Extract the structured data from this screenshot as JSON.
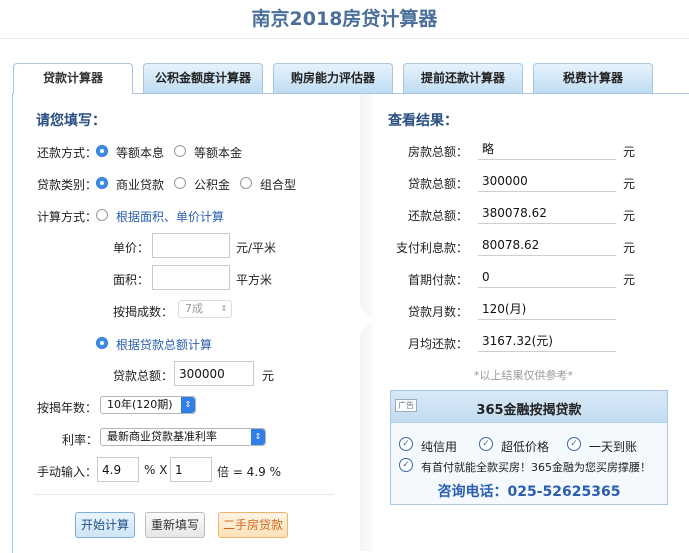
{
  "title": "南京2018房贷计算器",
  "tabs": [
    "贷款计算器",
    "公积金额度计算器",
    "购房能力评估器",
    "提前还款计算器",
    "税费计算器"
  ],
  "form": {
    "heading": "请您填写：",
    "repay_method": {
      "label": "还款方式：",
      "options": [
        "等额本息",
        "等额本金"
      ],
      "selected": "等额本息"
    },
    "loan_type": {
      "label": "贷款类别：",
      "options": [
        "商业贷款",
        "公积金",
        "组合型"
      ],
      "selected": "商业贷款"
    },
    "calc_method": {
      "label": "计算方式：",
      "by_area_label": "根据面积、单价计算",
      "unit_price_label": "单价：",
      "unit_price_value": "",
      "unit_price_unit": "元/平米",
      "area_label": "面积：",
      "area_value": "",
      "area_unit": "平方米",
      "ratio_label": "按揭成数：",
      "ratio_value": "7成",
      "by_total_label": "根据贷款总额计算",
      "total_label": "贷款总额：",
      "total_value": "300000",
      "total_unit": "元"
    },
    "years": {
      "label": "按揭年数：",
      "value": "10年(120期)"
    },
    "rate": {
      "label": "利率：",
      "value": "最新商业贷款基准利率"
    },
    "manual": {
      "label": "手动输入：",
      "rate_value": "4.9",
      "pct_x": "% X",
      "mult_value": "1",
      "result_text": "倍 = 4.9 %"
    },
    "buttons": {
      "start": "开始计算",
      "reset": "重新填写",
      "second_hand": "二手房贷款"
    }
  },
  "results": {
    "heading": "查看结果：",
    "rows": [
      {
        "label": "房款总额：",
        "value": "略",
        "unit": "元"
      },
      {
        "label": "贷款总额：",
        "value": "300000",
        "unit": "元"
      },
      {
        "label": "还款总额：",
        "value": "380078.62",
        "unit": "元"
      },
      {
        "label": "支付利息款：",
        "value": "80078.62",
        "unit": "元"
      },
      {
        "label": "首期付款：",
        "value": "0",
        "unit": "元"
      },
      {
        "label": "贷款月数：",
        "value": "120(月)",
        "unit": ""
      },
      {
        "label": "月均还款：",
        "value": "3167.32(元)",
        "unit": ""
      }
    ],
    "note": "*以上结果仅供参考*"
  },
  "ad": {
    "tag": "广告",
    "title": "365金融按揭贷款",
    "features": [
      "纯信用",
      "超低价格",
      "一天到账"
    ],
    "slogan": "有首付就能全款买房！365金融为您买房撑腰！",
    "phone": "咨询电话：025-52625365"
  },
  "colors": {
    "heading": "#2a5082",
    "accent": "#2f7fe6",
    "tab_bg": "#bfdcf2",
    "link": "#2a5eb0"
  }
}
